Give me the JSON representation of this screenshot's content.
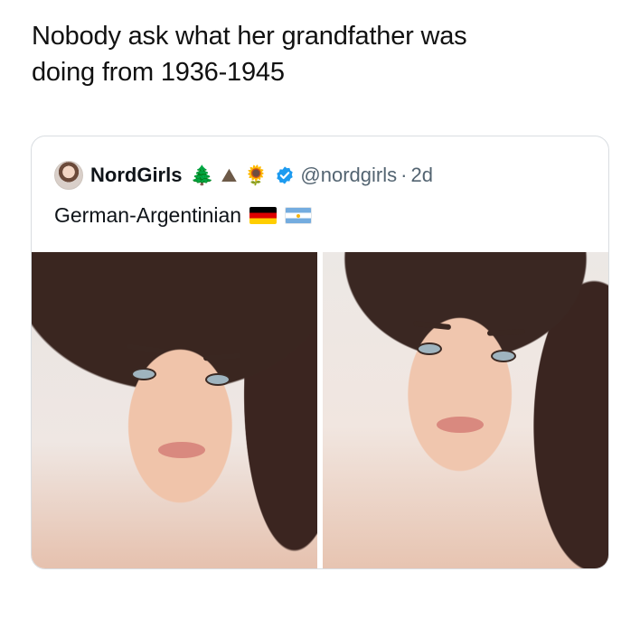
{
  "caption": {
    "line1": "Nobody ask what her grandfather was",
    "line2": "doing from 1936-1945"
  },
  "quote_tweet": {
    "display_name": "NordGirls",
    "emojis": {
      "tree": "🌲",
      "mountain": "⛰",
      "sunflower": "🌻"
    },
    "handle": "@nordgirls",
    "separator": "·",
    "age": "2d",
    "text": "German-Argentinian",
    "flags": [
      "germany-flag",
      "argentina-flag"
    ],
    "verified_color": "#1d9bf0",
    "media": [
      {
        "name": "photo-1",
        "icon": "photo"
      },
      {
        "name": "photo-2",
        "icon": "photo"
      }
    ]
  }
}
